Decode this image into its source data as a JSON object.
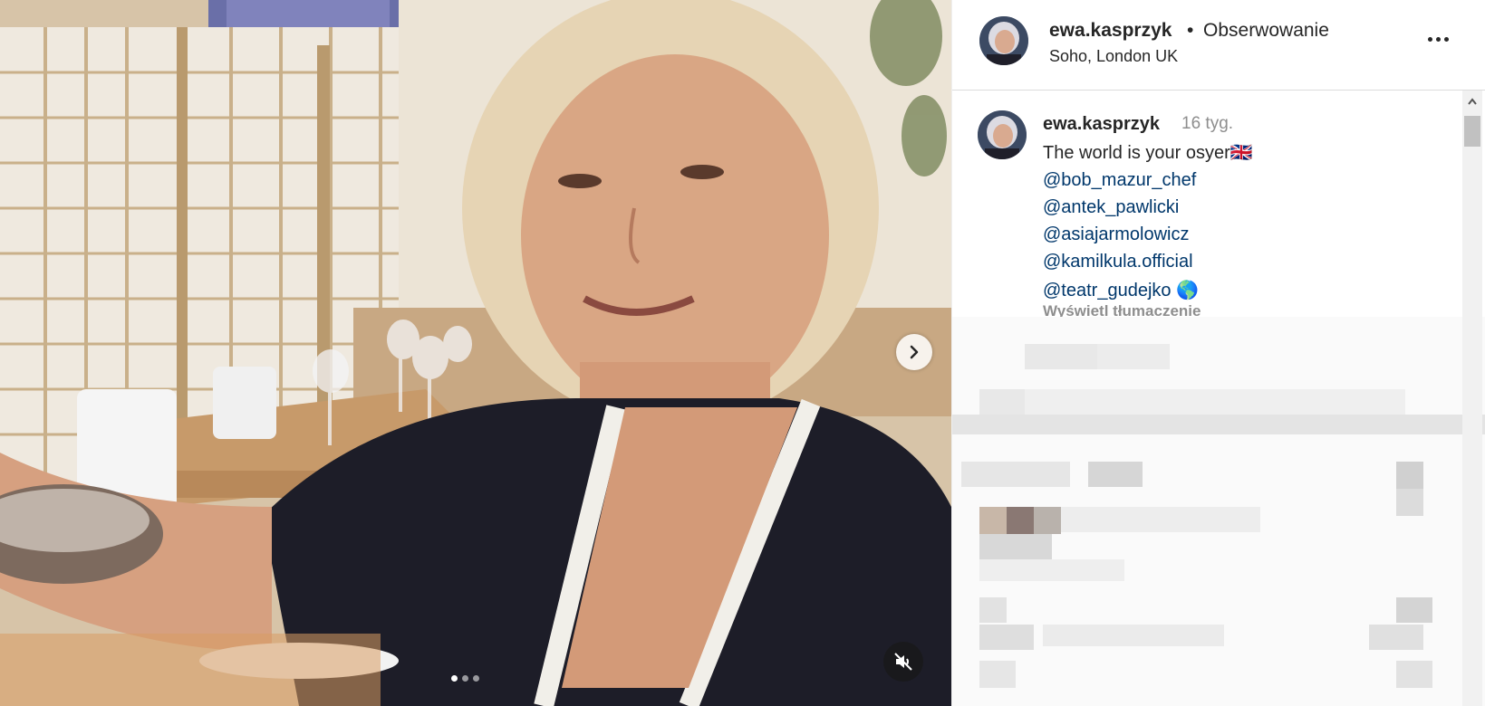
{
  "post": {
    "username": "ewa.kasprzyk",
    "separator": "•",
    "follow_label": "Obserwowanie",
    "location": "Soho, London UK",
    "more_icon": "more-options-icon"
  },
  "caption": {
    "username": "ewa.kasprzyk",
    "time_ago": "16 tyg.",
    "text": "The world is your osyer🇬🇧",
    "mentions": [
      "@bob_mazur_chef",
      "@antek_pawlicki",
      "@asiajarmolowicz",
      "@kamilkula.official",
      "@teatr_gudejko 🌎"
    ],
    "translate_label": "Wyświetl tłumaczenie"
  },
  "media": {
    "carousel_count": 3,
    "active_index": 0,
    "next_icon": "chevron-right-icon",
    "mute_icon": "muted-speaker-icon"
  },
  "colors": {
    "text": "#262626",
    "secondary": "#8e8e8e",
    "link": "#00376b"
  }
}
